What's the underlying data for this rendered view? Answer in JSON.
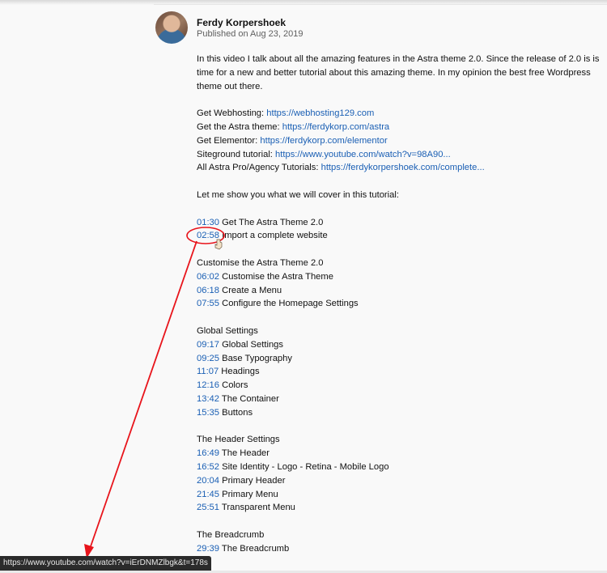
{
  "channel": {
    "author": "Ferdy Korpershoek",
    "published": "Published on Aug 23, 2019"
  },
  "description": {
    "intro": "In this video I talk about all the amazing features in the Astra theme 2.0. Since the release of 2.0 is is time for a new and better tutorial about this amazing theme. In my opinion the best free Wordpress theme out there.",
    "links": [
      {
        "label": "Get Webhosting: ",
        "url": "https://webhosting129.com"
      },
      {
        "label": "Get the Astra theme: ",
        "url": "https://ferdykorp.com/astra"
      },
      {
        "label": "Get Elementor: ",
        "url": "https://ferdykorp.com/elementor"
      },
      {
        "label": "Siteground tutorial: ",
        "url": "https://www.youtube.com/watch?v=98A90..."
      },
      {
        "label": "All Astra Pro/Agency Tutorials: ",
        "url": "https://ferdykorpershoek.com/complete..."
      }
    ],
    "cover_text": "Let me show you what we will cover in this tutorial:",
    "chapters": [
      {
        "time": "01:30",
        "title": " Get The Astra Theme 2.0"
      },
      {
        "time": "02:58",
        "title": " Import a complete website"
      }
    ],
    "sections": [
      {
        "heading": "Customise the Astra Theme 2.0",
        "items": [
          {
            "time": "06:02",
            "title": " Customise the Astra Theme"
          },
          {
            "time": "06:18",
            "title": " Create a Menu"
          },
          {
            "time": "07:55",
            "title": " Configure the Homepage Settings"
          }
        ]
      },
      {
        "heading": "Global Settings",
        "items": [
          {
            "time": "09:17",
            "title": " Global Settings"
          },
          {
            "time": "09:25",
            "title": " Base Typography"
          },
          {
            "time": "11:07",
            "title": " Headings"
          },
          {
            "time": "12:16",
            "title": " Colors"
          },
          {
            "time": "13:42",
            "title": " The Container"
          },
          {
            "time": "15:35",
            "title": " Buttons"
          }
        ]
      },
      {
        "heading": "The Header Settings",
        "items": [
          {
            "time": "16:49",
            "title": " The Header"
          },
          {
            "time": "16:52",
            "title": " Site Identity - Logo - Retina - Mobile Logo"
          },
          {
            "time": "20:04",
            "title": " Primary Header"
          },
          {
            "time": "21:45",
            "title": " Primary Menu"
          },
          {
            "time": "25:51",
            "title": " Transparent Menu"
          }
        ]
      },
      {
        "heading": "The Breadcrumb",
        "items": [
          {
            "time": "29:39",
            "title": " The Breadcrumb"
          }
        ]
      }
    ]
  },
  "status_bar": {
    "url": "https://www.youtube.com/watch?v=iErDNMZlbgk&t=178s"
  },
  "colors": {
    "link": "#1a5fb4",
    "annotation": "#e8141b",
    "status_bg": "#2b2b2b"
  }
}
